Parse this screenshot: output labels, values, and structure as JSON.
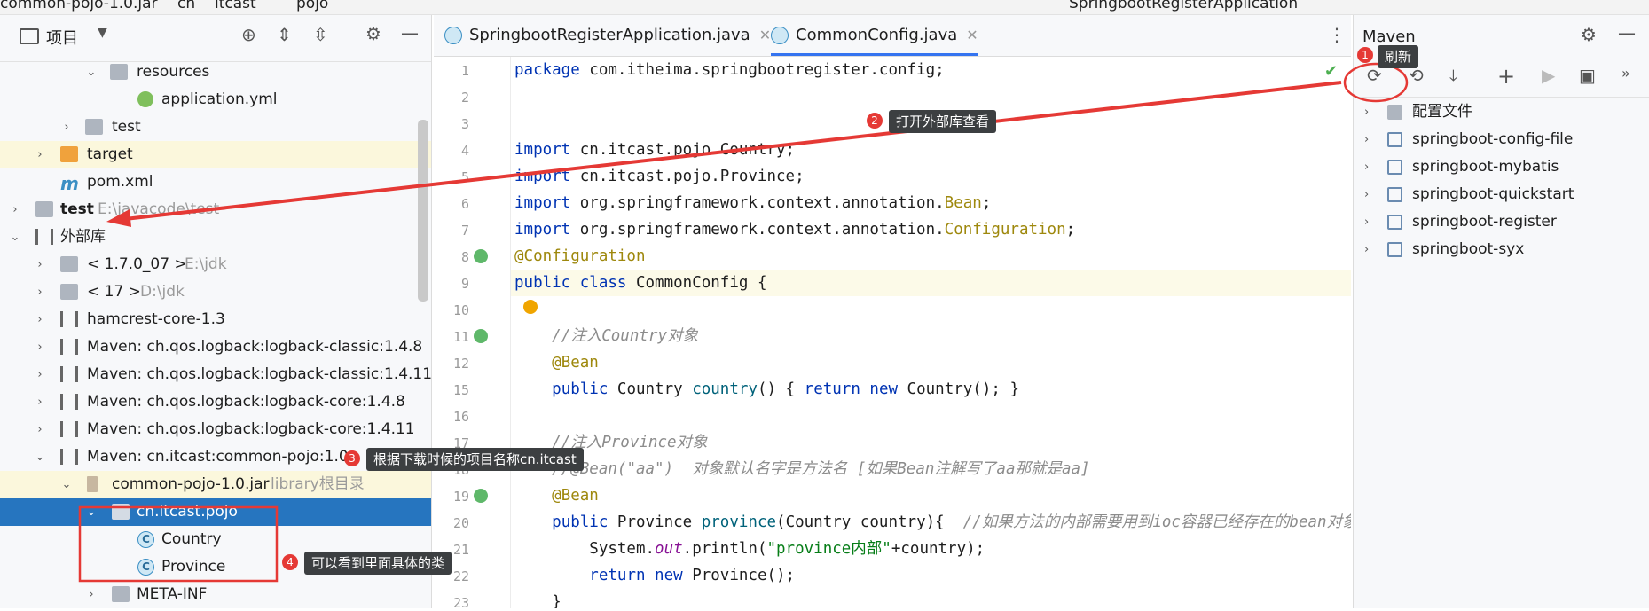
{
  "topbar": {
    "crumbs": [
      "common-pojo-1.0.jar",
      "cn",
      "itcast",
      "pojo"
    ],
    "run_config": "SpringbootRegisterApplication"
  },
  "project_panel": {
    "title": "项目",
    "tree": [
      {
        "label": "resources",
        "hint": ""
      },
      {
        "label": "application.yml",
        "hint": ""
      },
      {
        "label": "test",
        "hint": ""
      },
      {
        "label": "target",
        "hint": ""
      },
      {
        "label": "pom.xml",
        "hint": ""
      },
      {
        "label": "test",
        "hint": "E:\\javacode\\test"
      },
      {
        "label": "外部库",
        "hint": ""
      },
      {
        "label": "< 1.7.0_07 >",
        "hint": "E:\\jdk"
      },
      {
        "label": "< 17 >",
        "hint": "D:\\jdk"
      },
      {
        "label": "hamcrest-core-1.3",
        "hint": ""
      },
      {
        "label": "Maven: ch.qos.logback:logback-classic:1.4.8",
        "hint": ""
      },
      {
        "label": "Maven: ch.qos.logback:logback-classic:1.4.11",
        "hint": ""
      },
      {
        "label": "Maven: ch.qos.logback:logback-core:1.4.8",
        "hint": ""
      },
      {
        "label": "Maven: ch.qos.logback:logback-core:1.4.11",
        "hint": ""
      },
      {
        "label": "Maven: cn.itcast:common-pojo:1.0",
        "hint": ""
      },
      {
        "label": "common-pojo-1.0.jar",
        "hint": "library根目录"
      },
      {
        "label": "cn.itcast.pojo",
        "hint": ""
      },
      {
        "label": "Country",
        "hint": ""
      },
      {
        "label": "Province",
        "hint": ""
      },
      {
        "label": "META-INF",
        "hint": ""
      }
    ]
  },
  "editor": {
    "tabs": [
      {
        "label": "SpringbootRegisterApplication.java"
      },
      {
        "label": "CommonConfig.java"
      }
    ],
    "line_numbers": [
      "1",
      "2",
      "3",
      "4",
      "5",
      "6",
      "7",
      "8",
      "9",
      "10",
      "11",
      "12",
      "15",
      "16",
      "17",
      "18",
      "19",
      "20",
      "21",
      "22",
      "23"
    ]
  },
  "maven": {
    "title": "Maven",
    "items": [
      {
        "label": "配置文件"
      },
      {
        "label": "springboot-config-file"
      },
      {
        "label": "springboot-mybatis"
      },
      {
        "label": "springboot-quickstart"
      },
      {
        "label": "springboot-register"
      },
      {
        "label": "springboot-syx"
      }
    ]
  },
  "annotations": {
    "n1": "1",
    "t1": "刷新",
    "n2": "2",
    "t2": "打开外部库查看",
    "n3": "3",
    "t3": "根据下载时候的项目名称cn.itcast",
    "n4": "4",
    "t4": "可以看到里面具体的类"
  },
  "colors": {
    "selection": "#2675bf",
    "annotation_red": "#e53935",
    "accent": "#3574f0"
  }
}
